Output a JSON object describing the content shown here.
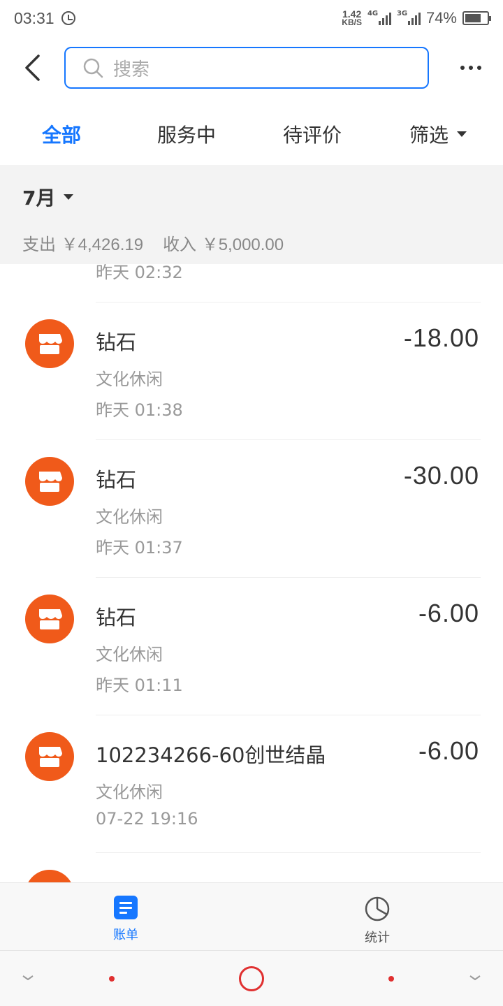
{
  "status_bar": {
    "time": "03:31",
    "net_speed_value": "1.42",
    "net_speed_unit": "KB/S",
    "signal_1_label": "4G",
    "signal_2_label": "3G",
    "battery_percent": "74%"
  },
  "header": {
    "search_placeholder": "搜索"
  },
  "tabs": [
    {
      "label": "全部",
      "active": true
    },
    {
      "label": "服务中",
      "active": false
    },
    {
      "label": "待评价",
      "active": false
    },
    {
      "label": "筛选",
      "active": false
    }
  ],
  "summary": {
    "month": "7月",
    "expense_label": "支出",
    "expense_value": "￥4,426.19",
    "income_label": "收入",
    "income_value": "￥5,000.00"
  },
  "list": {
    "partial_time": "昨天  02:32",
    "items": [
      {
        "title": "钻石",
        "category": "文化休闲",
        "time": "昨天  01:38",
        "amount": "-18.00"
      },
      {
        "title": "钻石",
        "category": "文化休闲",
        "time": "昨天  01:37",
        "amount": "-30.00"
      },
      {
        "title": "钻石",
        "category": "文化休闲",
        "time": "昨天  01:11",
        "amount": "-6.00"
      },
      {
        "title": "102234266-60创世结晶",
        "category": "文化休闲",
        "time": "07-22  19:16",
        "amount": "-6.00"
      }
    ]
  },
  "bottom_nav": [
    {
      "label": "账单",
      "icon": "bill-icon",
      "active": true
    },
    {
      "label": "统计",
      "icon": "pie-chart-icon",
      "active": false
    }
  ],
  "colors": {
    "accent": "#1677ff",
    "merchant_icon_bg": "#f05a1a",
    "home_button": "#e03030"
  }
}
